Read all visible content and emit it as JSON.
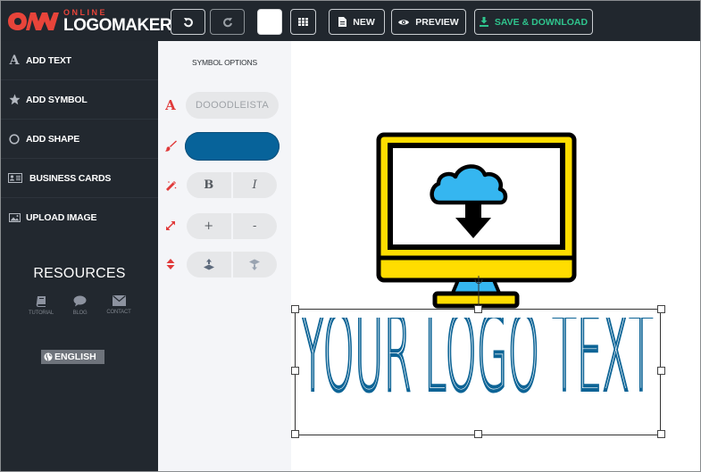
{
  "brand": {
    "top_word": "ONLINE",
    "bottom_word": "LOGOMAKER",
    "accent": "#e8443a"
  },
  "toolbar": {
    "undo_icon": "undo-icon",
    "redo_icon": "redo-icon",
    "background_color": "#ffffff",
    "grid_icon": "grid-icon",
    "new_label": "NEW",
    "preview_label": "PREVIEW",
    "save_label": "SAVE & DOWNLOAD",
    "save_color": "#2fc48d"
  },
  "sidebar": {
    "items": [
      {
        "label": "ADD TEXT",
        "icon": "text-icon"
      },
      {
        "label": "ADD SYMBOL",
        "icon": "star-icon"
      },
      {
        "label": "ADD SHAPE",
        "icon": "circle-icon"
      },
      {
        "label": "BUSINESS CARDS",
        "icon": "id-card-icon"
      },
      {
        "label": "UPLOAD IMAGE",
        "icon": "image-icon"
      }
    ],
    "resources_title": "RESOURCES",
    "resource_links": [
      {
        "label": "TUTORIAL",
        "icon": "book-icon"
      },
      {
        "label": "BLOG",
        "icon": "chat-bubble-icon"
      },
      {
        "label": "CONTACT",
        "icon": "envelope-icon"
      }
    ],
    "language": "ENGLISH"
  },
  "options": {
    "title": "SYMBOL OPTIONS",
    "font_name": "DOOODLEISTA",
    "selected_color": "#07639a",
    "bold_label": "B",
    "italic_label": "I",
    "size_increase_label": "+",
    "size_decrease_label": "-"
  },
  "canvas": {
    "logo_text": "YOUR LOGO TEXT",
    "logo_text_color": "#0d6496",
    "symbol": "computer-cloud-download",
    "symbol_colors": {
      "frame": "#ffdd00",
      "outline": "#000000",
      "cloud": "#35b6f0"
    }
  }
}
